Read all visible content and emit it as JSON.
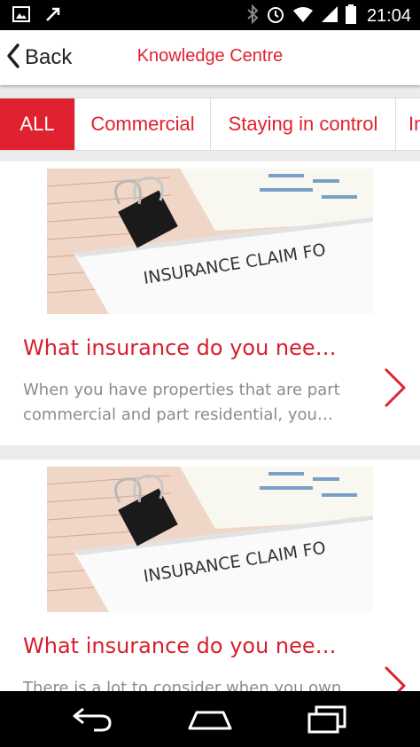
{
  "status_bar": {
    "time": "21:04",
    "icons": [
      "image-icon",
      "flight-icon",
      "bluetooth-icon",
      "alarm-icon",
      "wifi-icon",
      "signal-icon",
      "battery-icon"
    ]
  },
  "header": {
    "back_label": "Back",
    "title": "Knowledge Centre"
  },
  "tabs": [
    {
      "label": "ALL",
      "active": true
    },
    {
      "label": "Commercial",
      "active": false
    },
    {
      "label": "Staying in control",
      "active": false
    },
    {
      "label": "In",
      "active": false
    }
  ],
  "cards": [
    {
      "title": "What insurance do you nee…",
      "description": "When you have properties that are part commercial and part residential, you…",
      "image_caption": "INSURANCE CLAIM FO"
    },
    {
      "title": "What insurance do you nee…",
      "description": "There is a lot to consider when you own",
      "image_caption": "INSURANCE CLAIM FO"
    }
  ],
  "colors": {
    "accent": "#e0212f",
    "text_gray": "#8b8b8b",
    "background": "#ececec"
  }
}
